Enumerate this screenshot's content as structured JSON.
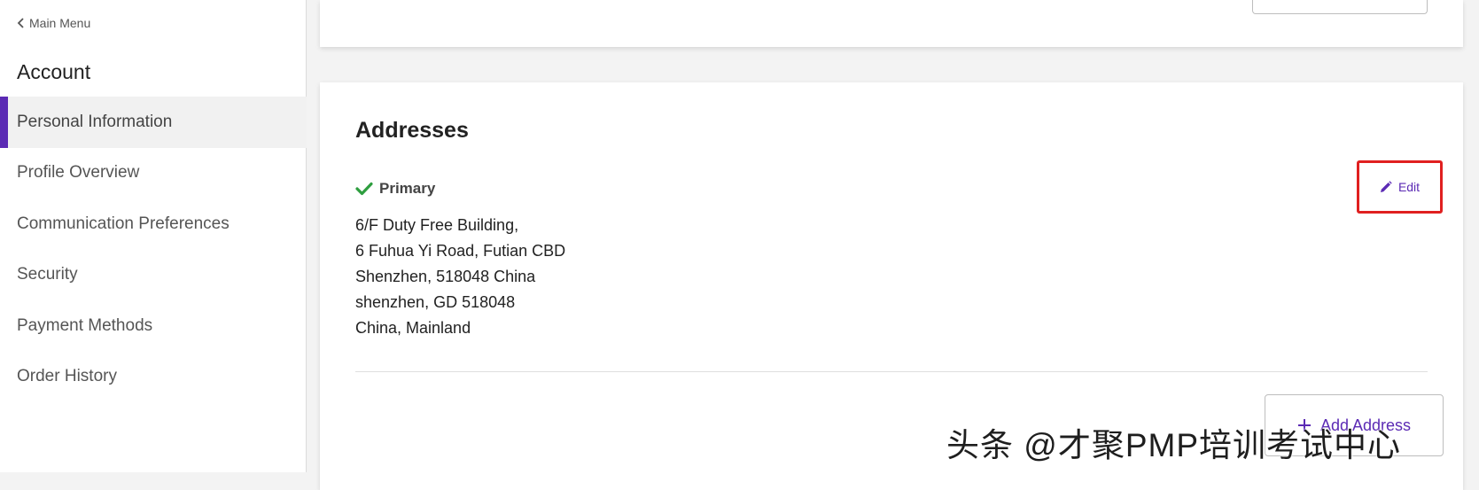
{
  "sidebar": {
    "back_label": "Main Menu",
    "section_title": "Account",
    "items": [
      {
        "label": "Personal Information",
        "active": true
      },
      {
        "label": "Profile Overview"
      },
      {
        "label": "Communication Preferences"
      },
      {
        "label": "Security"
      },
      {
        "label": "Payment Methods"
      },
      {
        "label": "Order History"
      }
    ]
  },
  "addresses": {
    "title": "Addresses",
    "primary_label": "Primary",
    "lines": [
      "6/F Duty Free Building,",
      "6 Fuhua Yi Road, Futian CBD",
      "Shenzhen, 518048 China",
      "shenzhen, GD 518048",
      "China, Mainland"
    ],
    "edit_label": "Edit",
    "add_label": "Add Address"
  },
  "watermark": "头条 @才聚PMP培训考试中心",
  "colors": {
    "accent": "#5b2ab4",
    "check": "#2e9e3f",
    "highlight_box": "#e02020"
  },
  "icons": {
    "back": "chevron-left-icon",
    "primary": "check-icon",
    "edit": "pencil-icon",
    "add": "plus-icon"
  }
}
